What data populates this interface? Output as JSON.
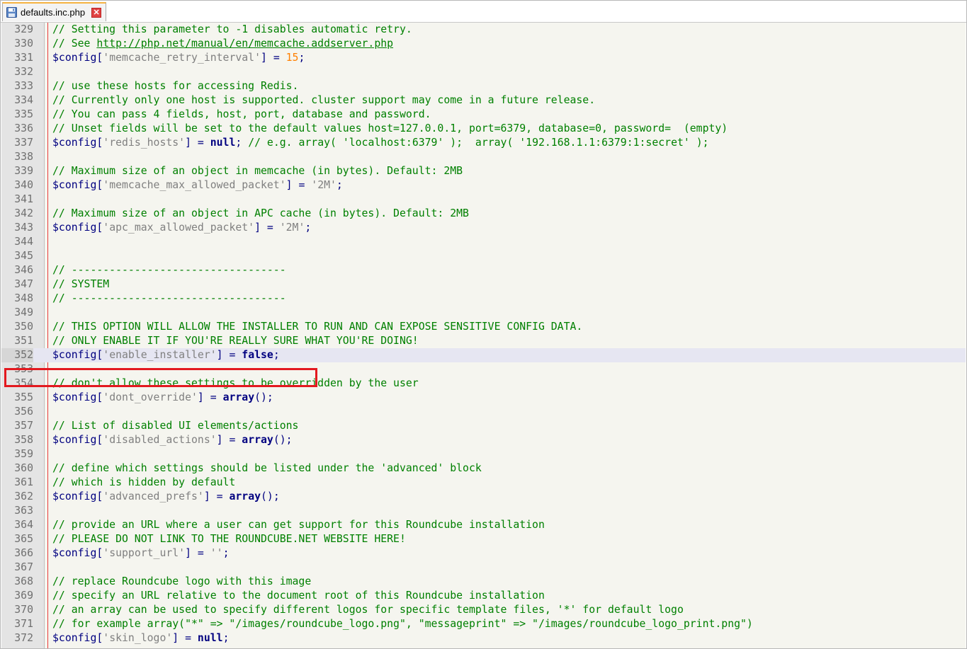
{
  "tab": {
    "filename": "defaults.inc.php",
    "icon": "save-icon",
    "close_icon": "close-icon",
    "close_glyph": "✕"
  },
  "colors": {
    "comment": "#008000",
    "string": "#808080",
    "number": "#ff8000",
    "keyword": "#000080",
    "highlight_box": "#e3191f"
  },
  "code_lines": [
    {
      "num": "329",
      "tokens": [
        {
          "t": "c",
          "v": "// Setting this parameter to -1 disables automatic retry."
        }
      ]
    },
    {
      "num": "330",
      "tokens": [
        {
          "t": "c",
          "v": "// See "
        },
        {
          "t": "u",
          "v": "http://php.net/manual/en/memcache.addserver.php"
        }
      ]
    },
    {
      "num": "331",
      "tokens": [
        {
          "t": "v",
          "v": "$config"
        },
        {
          "t": "p",
          "v": "["
        },
        {
          "t": "s",
          "v": "'memcache_retry_interval'"
        },
        {
          "t": "p",
          "v": "] = "
        },
        {
          "t": "n",
          "v": "15"
        },
        {
          "t": "p",
          "v": ";"
        }
      ]
    },
    {
      "num": "332",
      "tokens": []
    },
    {
      "num": "333",
      "tokens": [
        {
          "t": "c",
          "v": "// use these hosts for accessing Redis."
        }
      ]
    },
    {
      "num": "334",
      "tokens": [
        {
          "t": "c",
          "v": "// Currently only one host is supported. cluster support may come in a future release."
        }
      ]
    },
    {
      "num": "335",
      "tokens": [
        {
          "t": "c",
          "v": "// You can pass 4 fields, host, port, database and password."
        }
      ]
    },
    {
      "num": "336",
      "tokens": [
        {
          "t": "c",
          "v": "// Unset fields will be set to the default values host=127.0.0.1, port=6379, database=0, password=  (empty)"
        }
      ]
    },
    {
      "num": "337",
      "tokens": [
        {
          "t": "v",
          "v": "$config"
        },
        {
          "t": "p",
          "v": "["
        },
        {
          "t": "s",
          "v": "'redis_hosts'"
        },
        {
          "t": "p",
          "v": "] = "
        },
        {
          "t": "k",
          "v": "null"
        },
        {
          "t": "p",
          "v": "; "
        },
        {
          "t": "c",
          "v": "// e.g. array( 'localhost:6379' );  array( '192.168.1.1:6379:1:secret' );"
        }
      ]
    },
    {
      "num": "338",
      "tokens": []
    },
    {
      "num": "339",
      "tokens": [
        {
          "t": "c",
          "v": "// Maximum size of an object in memcache (in bytes). Default: 2MB"
        }
      ]
    },
    {
      "num": "340",
      "tokens": [
        {
          "t": "v",
          "v": "$config"
        },
        {
          "t": "p",
          "v": "["
        },
        {
          "t": "s",
          "v": "'memcache_max_allowed_packet'"
        },
        {
          "t": "p",
          "v": "] = "
        },
        {
          "t": "s",
          "v": "'2M'"
        },
        {
          "t": "p",
          "v": ";"
        }
      ]
    },
    {
      "num": "341",
      "tokens": []
    },
    {
      "num": "342",
      "tokens": [
        {
          "t": "c",
          "v": "// Maximum size of an object in APC cache (in bytes). Default: 2MB"
        }
      ]
    },
    {
      "num": "343",
      "tokens": [
        {
          "t": "v",
          "v": "$config"
        },
        {
          "t": "p",
          "v": "["
        },
        {
          "t": "s",
          "v": "'apc_max_allowed_packet'"
        },
        {
          "t": "p",
          "v": "] = "
        },
        {
          "t": "s",
          "v": "'2M'"
        },
        {
          "t": "p",
          "v": ";"
        }
      ]
    },
    {
      "num": "344",
      "tokens": []
    },
    {
      "num": "345",
      "tokens": []
    },
    {
      "num": "346",
      "tokens": [
        {
          "t": "c",
          "v": "// ----------------------------------"
        }
      ]
    },
    {
      "num": "347",
      "tokens": [
        {
          "t": "c",
          "v": "// SYSTEM"
        }
      ]
    },
    {
      "num": "348",
      "tokens": [
        {
          "t": "c",
          "v": "// ----------------------------------"
        }
      ]
    },
    {
      "num": "349",
      "tokens": []
    },
    {
      "num": "350",
      "tokens": [
        {
          "t": "c",
          "v": "// THIS OPTION WILL ALLOW THE INSTALLER TO RUN AND CAN EXPOSE SENSITIVE CONFIG DATA."
        }
      ]
    },
    {
      "num": "351",
      "tokens": [
        {
          "t": "c",
          "v": "// ONLY ENABLE IT IF YOU'RE REALLY SURE WHAT YOU'RE DOING!"
        }
      ]
    },
    {
      "num": "352",
      "current": true,
      "tokens": [
        {
          "t": "v",
          "v": "$config"
        },
        {
          "t": "p",
          "v": "["
        },
        {
          "t": "s",
          "v": "'enable_installer'"
        },
        {
          "t": "p",
          "v": "] = "
        },
        {
          "t": "k",
          "v": "false"
        },
        {
          "t": "p",
          "v": ";"
        }
      ]
    },
    {
      "num": "353",
      "tokens": []
    },
    {
      "num": "354",
      "tokens": [
        {
          "t": "c",
          "v": "// don't allow these settings to be overridden by the user"
        }
      ]
    },
    {
      "num": "355",
      "tokens": [
        {
          "t": "v",
          "v": "$config"
        },
        {
          "t": "p",
          "v": "["
        },
        {
          "t": "s",
          "v": "'dont_override'"
        },
        {
          "t": "p",
          "v": "] = "
        },
        {
          "t": "k",
          "v": "array"
        },
        {
          "t": "p",
          "v": "();"
        }
      ]
    },
    {
      "num": "356",
      "tokens": []
    },
    {
      "num": "357",
      "tokens": [
        {
          "t": "c",
          "v": "// List of disabled UI elements/actions"
        }
      ]
    },
    {
      "num": "358",
      "tokens": [
        {
          "t": "v",
          "v": "$config"
        },
        {
          "t": "p",
          "v": "["
        },
        {
          "t": "s",
          "v": "'disabled_actions'"
        },
        {
          "t": "p",
          "v": "] = "
        },
        {
          "t": "k",
          "v": "array"
        },
        {
          "t": "p",
          "v": "();"
        }
      ]
    },
    {
      "num": "359",
      "tokens": []
    },
    {
      "num": "360",
      "tokens": [
        {
          "t": "c",
          "v": "// define which settings should be listed under the 'advanced' block"
        }
      ]
    },
    {
      "num": "361",
      "tokens": [
        {
          "t": "c",
          "v": "// which is hidden by default"
        }
      ]
    },
    {
      "num": "362",
      "tokens": [
        {
          "t": "v",
          "v": "$config"
        },
        {
          "t": "p",
          "v": "["
        },
        {
          "t": "s",
          "v": "'advanced_prefs'"
        },
        {
          "t": "p",
          "v": "] = "
        },
        {
          "t": "k",
          "v": "array"
        },
        {
          "t": "p",
          "v": "();"
        }
      ]
    },
    {
      "num": "363",
      "tokens": []
    },
    {
      "num": "364",
      "tokens": [
        {
          "t": "c",
          "v": "// provide an URL where a user can get support for this Roundcube installation"
        }
      ]
    },
    {
      "num": "365",
      "tokens": [
        {
          "t": "c",
          "v": "// PLEASE DO NOT LINK TO THE ROUNDCUBE.NET WEBSITE HERE!"
        }
      ]
    },
    {
      "num": "366",
      "tokens": [
        {
          "t": "v",
          "v": "$config"
        },
        {
          "t": "p",
          "v": "["
        },
        {
          "t": "s",
          "v": "'support_url'"
        },
        {
          "t": "p",
          "v": "] = "
        },
        {
          "t": "s",
          "v": "''"
        },
        {
          "t": "p",
          "v": ";"
        }
      ]
    },
    {
      "num": "367",
      "tokens": []
    },
    {
      "num": "368",
      "tokens": [
        {
          "t": "c",
          "v": "// replace Roundcube logo with this image"
        }
      ]
    },
    {
      "num": "369",
      "tokens": [
        {
          "t": "c",
          "v": "// specify an URL relative to the document root of this Roundcube installation"
        }
      ]
    },
    {
      "num": "370",
      "tokens": [
        {
          "t": "c",
          "v": "// an array can be used to specify different logos for specific template files, '*' for default logo"
        }
      ]
    },
    {
      "num": "371",
      "tokens": [
        {
          "t": "c",
          "v": "// for example array(\"*\" => \"/images/roundcube_logo.png\", \"messageprint\" => \"/images/roundcube_logo_print.png\")"
        }
      ]
    },
    {
      "num": "372",
      "tokens": [
        {
          "t": "v",
          "v": "$config"
        },
        {
          "t": "p",
          "v": "["
        },
        {
          "t": "s",
          "v": "'skin_logo'"
        },
        {
          "t": "p",
          "v": "] = "
        },
        {
          "t": "k",
          "v": "null"
        },
        {
          "t": "p",
          "v": ";"
        }
      ]
    }
  ]
}
